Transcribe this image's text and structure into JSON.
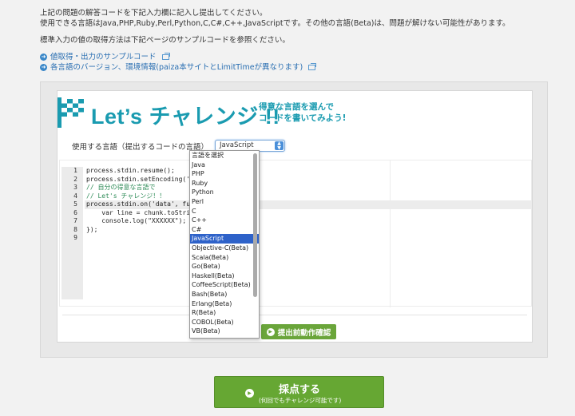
{
  "intro": {
    "line1": "上記の問題の解答コードを下記入力欄に記入し提出してください。",
    "line2": "使用できる言語はJava,PHP,Ruby,Perl,Python,C,C#,C++,JavaScriptです。その他の言語(Beta)は、問題が解けない可能性があります。",
    "line3": "標準入力の値の取得方法は下記ページのサンプルコードを参照ください。"
  },
  "links": [
    {
      "label": "値取得・出力のサンプルコード",
      "icon": "arrow-circle-icon"
    },
    {
      "label": "各言語のバージョン、環境情報(paiza本サイトとLimitTimeが異なります)",
      "icon": "arrow-circle-icon"
    }
  ],
  "banner": {
    "title": "Let’s チャレンジ !!",
    "subtitle_1": "得意な言語を選んで",
    "subtitle_2": "コードを書いてみよう!",
    "color": "#1a9bb0"
  },
  "language": {
    "label": "使用する言語（提出するコードの言語）",
    "selected": "JavaScript",
    "options": [
      "言語を選択",
      "Java",
      "PHP",
      "Ruby",
      "Python",
      "Perl",
      "C",
      "C++",
      "C#",
      "JavaScript",
      "Objective-C(Beta)",
      "Scala(Beta)",
      "Go(Beta)",
      "Haskell(Beta)",
      "CoffeeScript(Beta)",
      "Bash(Beta)",
      "Erlang(Beta)",
      "R(Beta)",
      "COBOL(Beta)",
      "VB(Beta)"
    ]
  },
  "editor": {
    "line_numbers": [
      "1",
      "2",
      "3",
      "4",
      "5",
      "6",
      "7",
      "8",
      "9"
    ],
    "lines": [
      "process.stdin.resume();",
      "process.stdin.setEncoding('u",
      "// 自分の得意な言語で",
      "// Let's チャレンジ！！",
      "process.stdin.on('data', fun",
      "    var line = chunk.toStrin",
      "    console.log(\"XXXXXX\");",
      "});",
      ""
    ]
  },
  "buttons": {
    "pre_submit": "提出前動作確認",
    "submit_main": "採点する",
    "submit_sub": "(何回でもチャレンジ可能です)"
  },
  "colors": {
    "accent": "#1a9bb0",
    "green": "#66a733",
    "link": "#2a6fb2",
    "selection": "#2e62c9"
  }
}
